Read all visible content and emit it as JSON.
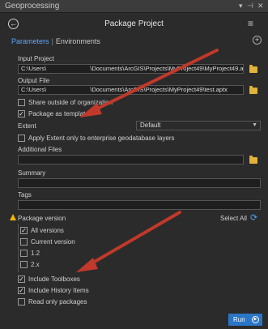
{
  "window": {
    "title": "Geoprocessing"
  },
  "tool": {
    "title": "Package Project"
  },
  "tabs": [
    {
      "label": "Parameters"
    },
    {
      "label": "Environments"
    }
  ],
  "input_project": {
    "label": "Input Project",
    "value_prefix": "C:\\Users\\",
    "value_suffix": "\\Documents\\ArcGIS\\Projects\\MyProject49\\MyProject49.aprx"
  },
  "output_file": {
    "label": "Output File",
    "value_prefix": "C:\\Users\\",
    "value_suffix": "\\Documents\\ArcGIS\\Projects\\MyProject49\\test.aptx"
  },
  "share_outside": {
    "label": "Share outside of organization",
    "checked": false
  },
  "package_template": {
    "label": "Package as template",
    "checked": true
  },
  "extent": {
    "label": "Extent",
    "value": "Default"
  },
  "apply_extent": {
    "label": "Apply Extent only to enterprise geodatabase layers",
    "checked": false
  },
  "additional_files": {
    "label": "Additional Files",
    "value": ""
  },
  "summary": {
    "label": "Summary",
    "value": ""
  },
  "tags": {
    "label": "Tags",
    "value": ""
  },
  "package_version": {
    "label": "Package version",
    "select_all_label": "Select All",
    "options": [
      {
        "label": "All versions",
        "checked": true
      },
      {
        "label": "Current version",
        "checked": false
      },
      {
        "label": "1.2",
        "checked": false
      },
      {
        "label": "2.x",
        "checked": false
      }
    ]
  },
  "include_toolboxes": {
    "label": "Include Toolboxes",
    "checked": true
  },
  "include_history": {
    "label": "Include History Items",
    "checked": true
  },
  "read_only": {
    "label": "Read only packages",
    "checked": false
  },
  "run_button": {
    "label": "Run"
  },
  "colors": {
    "accent": "#2a76c6",
    "annotation_arrow": "#c0392b",
    "warning": "#f1b500"
  },
  "icons": [
    "back-icon",
    "menu-icon",
    "plus-icon",
    "folder-icon",
    "warning-icon",
    "refresh-icon",
    "play-icon",
    "chevron-down-icon",
    "pin-icon",
    "close-icon"
  ]
}
